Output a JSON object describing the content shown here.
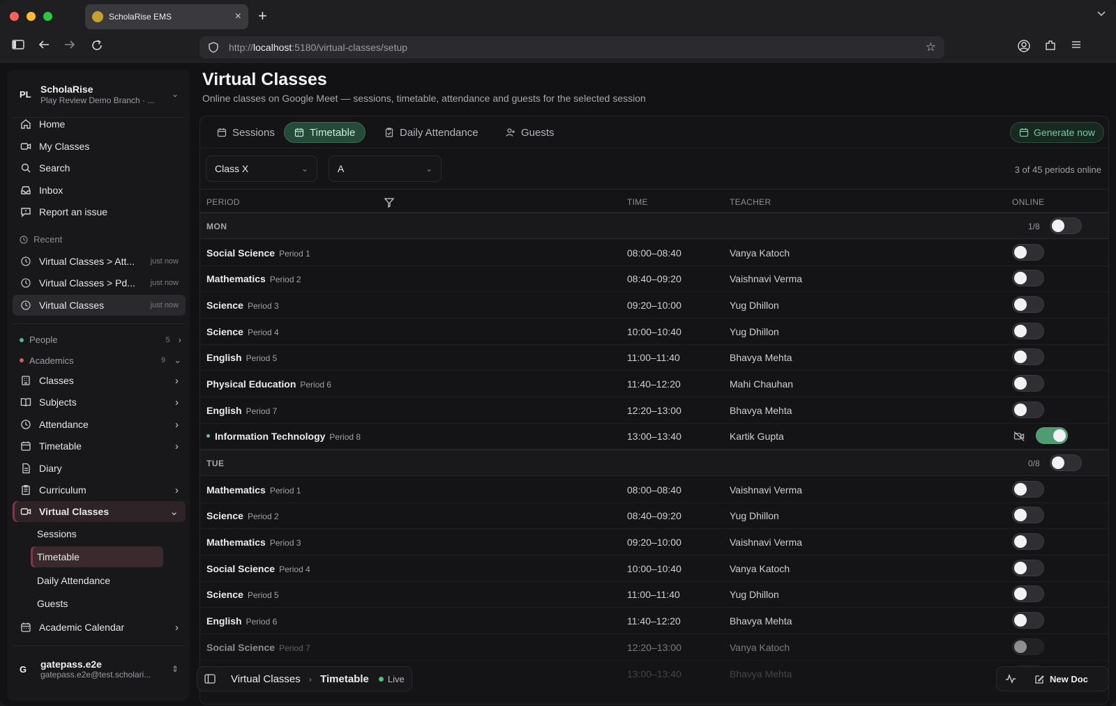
{
  "browser": {
    "tab_title": "ScholaRise EMS",
    "url_prefix": "http://",
    "url_host": "localhost",
    "url_path": ":5180/virtual-classes/setup"
  },
  "sidebar": {
    "org_badge": "PL",
    "org_name": "ScholaRise",
    "org_branch": "Play Review Demo Branch · ...",
    "nav": [
      {
        "label": "Home",
        "icon": "home-icon"
      },
      {
        "label": "My Classes",
        "icon": "video-icon"
      },
      {
        "label": "Search",
        "icon": "search-icon"
      },
      {
        "label": "Inbox",
        "icon": "inbox-icon"
      },
      {
        "label": "Report an issue",
        "icon": "message-alert-icon"
      }
    ],
    "recent_label": "Recent",
    "recent": [
      {
        "label": "Virtual Classes > Att...",
        "time": "just now"
      },
      {
        "label": "Virtual Classes > Pd...",
        "time": "just now"
      },
      {
        "label": "Virtual Classes",
        "time": "just now"
      }
    ],
    "groups": [
      {
        "label": "People",
        "count": "5",
        "color": "#4fbf7f"
      },
      {
        "label": "Academics",
        "count": "9",
        "color": "#d65a5a"
      }
    ],
    "academics": [
      {
        "label": "Classes"
      },
      {
        "label": "Subjects"
      },
      {
        "label": "Attendance"
      },
      {
        "label": "Timetable"
      },
      {
        "label": "Diary"
      },
      {
        "label": "Curriculum"
      },
      {
        "label": "Virtual Classes"
      }
    ],
    "virtual_sub": [
      "Sessions",
      "Timetable",
      "Daily Attendance",
      "Guests"
    ],
    "academic_calendar": "Academic Calendar",
    "user_initial": "G",
    "user_name": "gatepass.e2e",
    "user_email": "gatepass.e2e@test.scholari..."
  },
  "page": {
    "title": "Virtual Classes",
    "subtitle": "Online classes on Google Meet — sessions, timetable, attendance and guests for the selected session"
  },
  "tabs": [
    {
      "label": "Sessions"
    },
    {
      "label": "Timetable"
    },
    {
      "label": "Daily Attendance"
    },
    {
      "label": "Guests"
    }
  ],
  "generate_label": "Generate now",
  "filters": {
    "class": "Class X",
    "section": "A"
  },
  "periods_online": "3 of 45 periods online",
  "columns": {
    "period": "PERIOD",
    "time": "TIME",
    "teacher": "TEACHER",
    "online": "ONLINE"
  },
  "days": [
    {
      "label": "MON",
      "count": "1/8",
      "all_on": false,
      "periods": [
        {
          "subject": "Social Science",
          "period": "Period 1",
          "time": "08:00–08:40",
          "teacher": "Vanya Katoch",
          "online": false
        },
        {
          "subject": "Mathematics",
          "period": "Period 2",
          "time": "08:40–09:20",
          "teacher": "Vaishnavi Verma",
          "online": false
        },
        {
          "subject": "Science",
          "period": "Period 3",
          "time": "09:20–10:00",
          "teacher": "Yug Dhillon",
          "online": false
        },
        {
          "subject": "Science",
          "period": "Period 4",
          "time": "10:00–10:40",
          "teacher": "Yug Dhillon",
          "online": false
        },
        {
          "subject": "English",
          "period": "Period 5",
          "time": "11:00–11:40",
          "teacher": "Bhavya Mehta",
          "online": false
        },
        {
          "subject": "Physical Education",
          "period": "Period 6",
          "time": "11:40–12:20",
          "teacher": "Mahi Chauhan",
          "online": false
        },
        {
          "subject": "English",
          "period": "Period 7",
          "time": "12:20–13:00",
          "teacher": "Bhavya Mehta",
          "online": false
        },
        {
          "subject": "Information Technology",
          "period": "Period 8",
          "time": "13:00–13:40",
          "teacher": "Kartik Gupta",
          "online": true
        }
      ]
    },
    {
      "label": "TUE",
      "count": "0/8",
      "all_on": false,
      "periods": [
        {
          "subject": "Mathematics",
          "period": "Period 1",
          "time": "08:00–08:40",
          "teacher": "Vaishnavi Verma",
          "online": false
        },
        {
          "subject": "Science",
          "period": "Period 2",
          "time": "08:40–09:20",
          "teacher": "Yug Dhillon",
          "online": false
        },
        {
          "subject": "Mathematics",
          "period": "Period 3",
          "time": "09:20–10:00",
          "teacher": "Vaishnavi Verma",
          "online": false
        },
        {
          "subject": "Social Science",
          "period": "Period 4",
          "time": "10:00–10:40",
          "teacher": "Vanya Katoch",
          "online": false
        },
        {
          "subject": "Science",
          "period": "Period 5",
          "time": "11:00–11:40",
          "teacher": "Yug Dhillon",
          "online": false
        },
        {
          "subject": "English",
          "period": "Period 6",
          "time": "11:40–12:20",
          "teacher": "Bhavya Mehta",
          "online": false
        },
        {
          "subject": "Social Science",
          "period": "Period 7",
          "time": "12:20–13:00",
          "teacher": "Vanya Katoch",
          "online": false
        },
        {
          "subject": "",
          "period": "",
          "time": "13:00–13:40",
          "teacher": "Bhavya Mehta",
          "online": false
        }
      ]
    }
  ],
  "bottom": {
    "crumb_1": "Virtual Classes",
    "crumb_2": "Timetable",
    "live": "Live",
    "new_doc": "New Doc"
  },
  "colors": {
    "accent_green": "#4f9b72",
    "active_maroon": "#7d3a4a"
  }
}
